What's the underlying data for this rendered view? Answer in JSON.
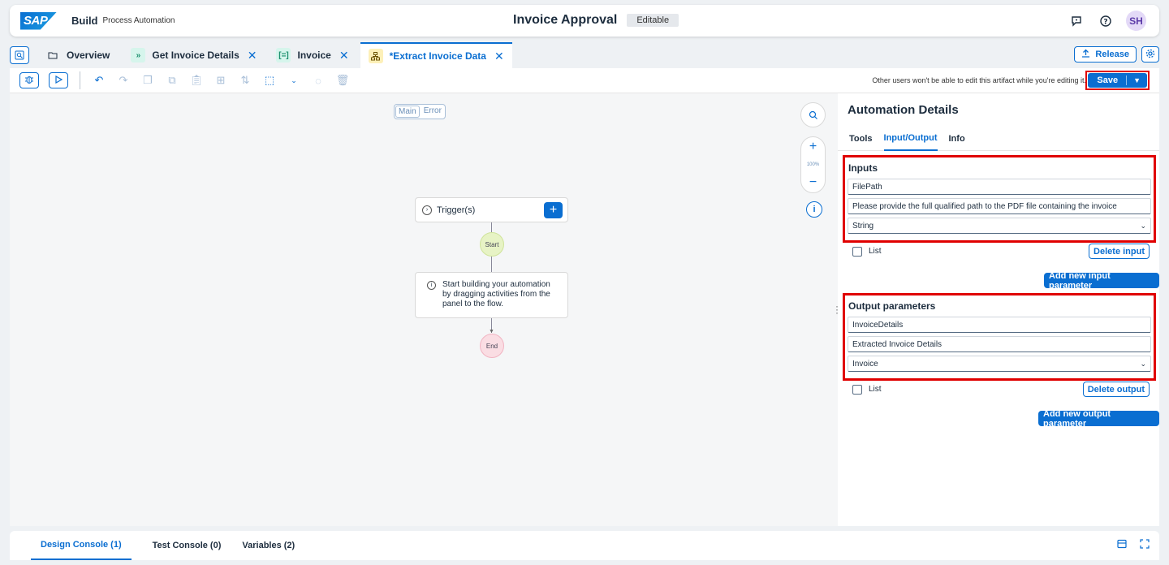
{
  "shell": {
    "logo": "SAP",
    "product": "Build",
    "subproduct": "Process Automation",
    "title": "Invoice Approval",
    "status_badge": "Editable",
    "avatar_initials": "SH"
  },
  "tabs": [
    {
      "label": "Overview",
      "icon": "folder-icon"
    },
    {
      "label": "Get Invoice Details",
      "icon": "chevrons-icon",
      "closable": true
    },
    {
      "label": "Invoice",
      "icon": "data-type-icon",
      "closable": true
    },
    {
      "label": "*Extract Invoice Data",
      "icon": "automation-icon",
      "closable": true,
      "active": true
    }
  ],
  "tab_close_glyph": "✕",
  "release_label": "Release",
  "toolbar": {
    "note": "Other users won't be able to edit this artifact while you're editing it.",
    "save_label": "Save"
  },
  "canvas": {
    "segments": [
      "Main",
      "Error"
    ],
    "zoom_level": "100%",
    "trigger_label": "Trigger(s)",
    "start_label": "Start",
    "end_label": "End",
    "info_text": "Start building your automation by dragging activities from the panel to the flow."
  },
  "panel": {
    "title": "Automation Details",
    "tabs": [
      "Tools",
      "Input/Output",
      "Info"
    ],
    "active_tab": "Input/Output",
    "inputs": {
      "heading": "Inputs",
      "name": "FilePath",
      "description": "Please provide the full qualified path to the PDF file containing the invoice",
      "type": "String",
      "list_label": "List",
      "delete_label": "Delete input",
      "add_label": "Add new input parameter"
    },
    "outputs": {
      "heading": "Output parameters",
      "name": "InvoiceDetails",
      "description": "Extracted Invoice Details",
      "type": "Invoice",
      "list_label": "List",
      "delete_label": "Delete output",
      "add_label": "Add new output parameter"
    }
  },
  "footer": {
    "tabs": [
      "Design Console (1)",
      "Test Console (0)",
      "Variables (2)"
    ],
    "active": "Design Console (1)"
  },
  "colors": {
    "accent": "#0a6ed1",
    "highlight_box": "#e00000",
    "start_node": "#e7f3c5",
    "end_node": "#fadde3"
  }
}
